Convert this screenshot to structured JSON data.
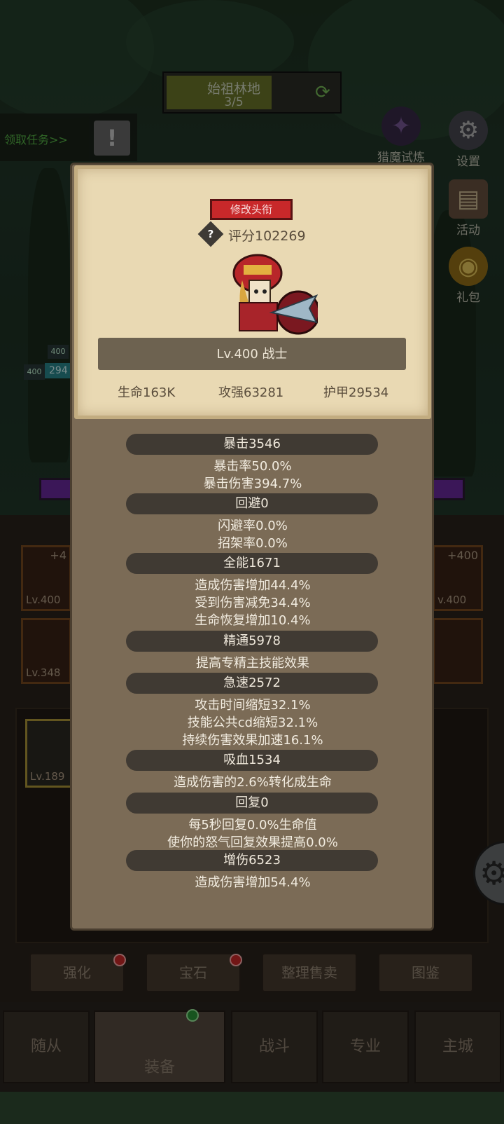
{
  "stage": {
    "name": "始祖林地",
    "progress": "3/5"
  },
  "quest": {
    "label": "领取任务>>",
    "alert_icon": "!"
  },
  "side_menu": [
    {
      "label": "猎魔试炼",
      "icon": "wing-icon"
    },
    {
      "label": "设置",
      "icon": "gear-icon"
    },
    {
      "label": "活动",
      "icon": "scroll-icon"
    },
    {
      "label": "礼包",
      "icon": "giftbag-icon"
    }
  ],
  "background_hp": {
    "lvl_a": "400",
    "lvl_b": "400",
    "hp": "294"
  },
  "equip_slots": [
    {
      "plus": "+4",
      "level": "Lv.400"
    },
    {
      "plus": "",
      "level": "Lv.348"
    },
    {
      "plus": "+400",
      "level": "v.400"
    },
    {
      "plus": "",
      "level": ""
    }
  ],
  "bag": {
    "item_level": "Lv.189"
  },
  "bottom_buttons": [
    "强化",
    "宝石",
    "整理售卖",
    "图鉴"
  ],
  "nav_tabs": [
    "随从",
    "装备",
    "战斗",
    "专业",
    "主城"
  ],
  "popup": {
    "edit_title_button": "修改头衔",
    "help_symbol": "?",
    "score": "评分102269",
    "level_class": "Lv.400 战士",
    "hp": "生命163K",
    "attack": "攻强63281",
    "armor": "护甲29534",
    "sections": [
      {
        "header": "暴击3546",
        "lines": [
          "暴击率50.0%",
          "暴击伤害394.7%"
        ]
      },
      {
        "header": "回避0",
        "lines": [
          "闪避率0.0%",
          "招架率0.0%"
        ]
      },
      {
        "header": "全能1671",
        "lines": [
          "造成伤害增加44.4%",
          "受到伤害减免34.4%",
          "生命恢复增加10.4%"
        ]
      },
      {
        "header": "精通5978",
        "lines": [
          "提高专精主技能效果"
        ]
      },
      {
        "header": "急速2572",
        "lines": [
          "攻击时间缩短32.1%",
          "技能公共cd缩短32.1%",
          "持续伤害效果加速16.1%"
        ]
      },
      {
        "header": "吸血1534",
        "lines": [
          "造成伤害的2.6%转化成生命"
        ]
      },
      {
        "header": "回复0",
        "lines": [
          "每5秒回复0.0%生命值",
          "使你的怒气回复效果提高0.0%"
        ]
      },
      {
        "header": "增伤6523",
        "lines": [
          "造成伤害增加54.4%"
        ]
      }
    ]
  }
}
